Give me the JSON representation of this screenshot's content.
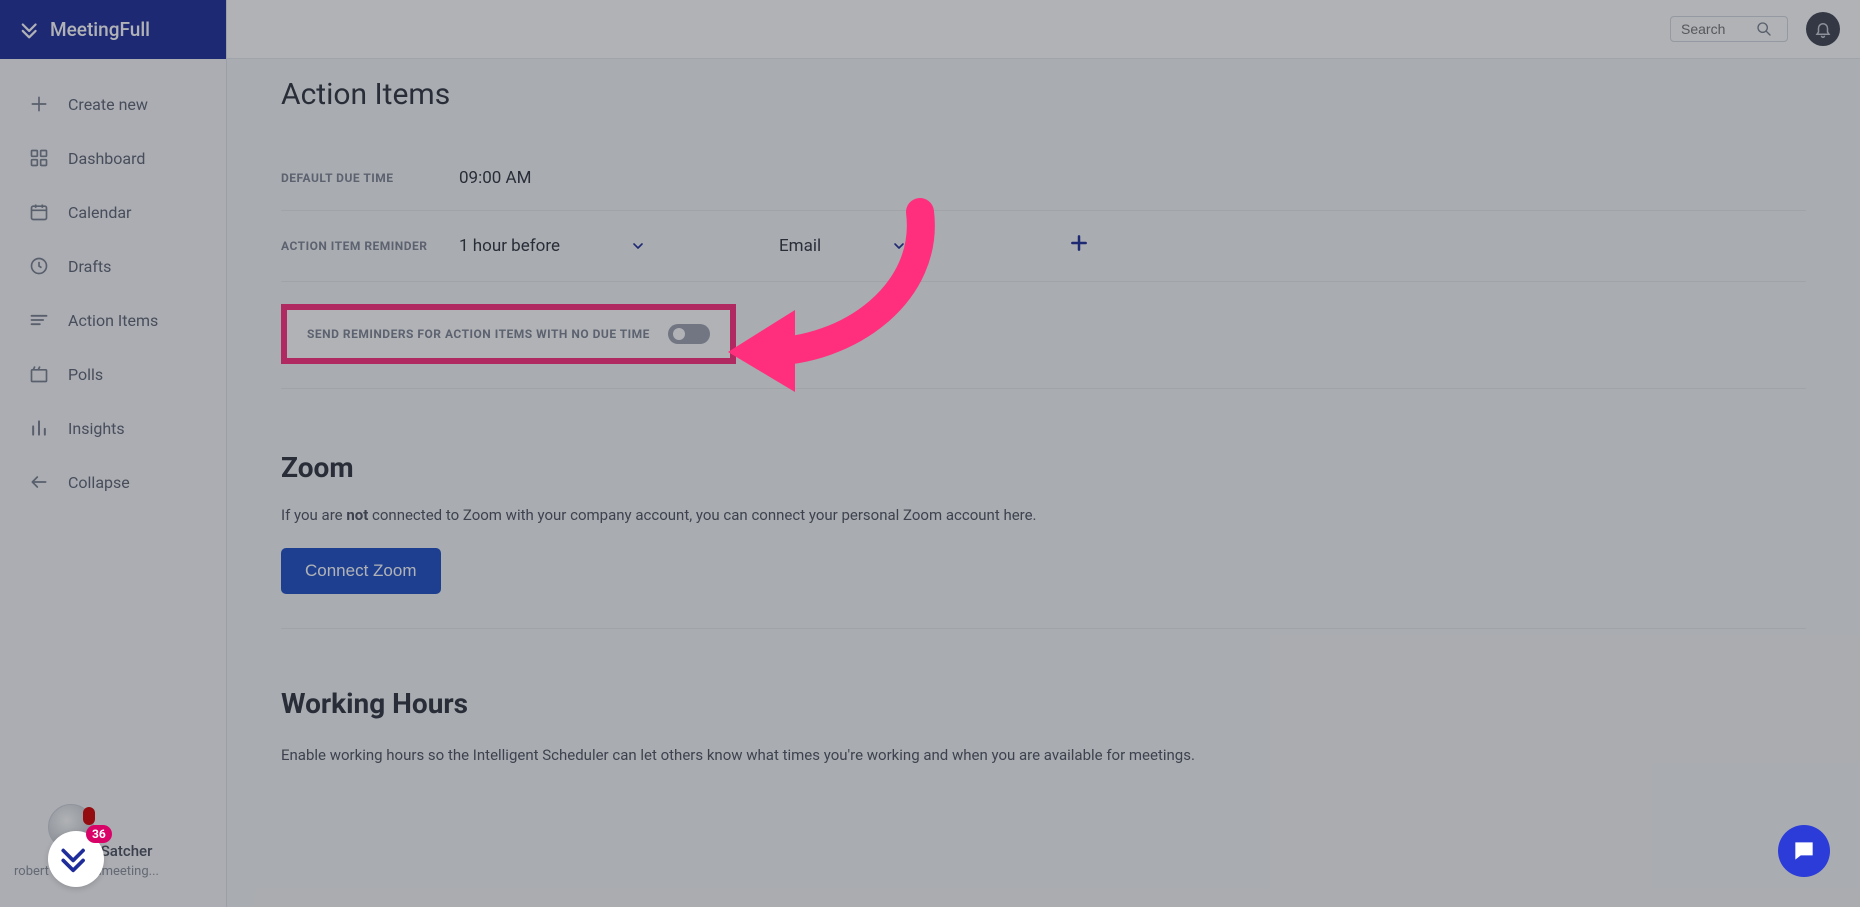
{
  "brand": {
    "name": "MeetingFull"
  },
  "sidebar": {
    "items": [
      {
        "label": "Create new",
        "icon": "plus"
      },
      {
        "label": "Dashboard",
        "icon": "dashboard"
      },
      {
        "label": "Calendar",
        "icon": "calendar"
      },
      {
        "label": "Drafts",
        "icon": "clock"
      },
      {
        "label": "Action Items",
        "icon": "lines"
      },
      {
        "label": "Polls",
        "icon": "polls"
      },
      {
        "label": "Insights",
        "icon": "bars"
      },
      {
        "label": "Collapse",
        "icon": "arrow-left"
      }
    ]
  },
  "user": {
    "name": "t Satcher",
    "email": "robert        r@moonmeeting...",
    "chat_badge": "36"
  },
  "topbar": {
    "search_placeholder": "Search"
  },
  "action_items": {
    "title": "Action Items",
    "default_due_time_label": "DEFAULT DUE TIME",
    "default_due_time_value": "09:00 AM",
    "reminder_label": "ACTION ITEM REMINDER",
    "reminder_time_value": "1 hour before",
    "reminder_channel_value": "Email",
    "no_due_toggle_label": "SEND REMINDERS FOR ACTION ITEMS WITH NO DUE TIME"
  },
  "zoom": {
    "title": "Zoom",
    "desc_prefix": "If you are ",
    "desc_bold": "not",
    "desc_suffix": " connected to Zoom with your company account, you can connect your personal Zoom account here.",
    "connect_label": "Connect Zoom"
  },
  "working_hours": {
    "title": "Working Hours",
    "desc": "Enable working hours so the Intelligent Scheduler can let others know what times you're working and when you are available for meetings."
  },
  "annotation": {
    "arrow_color": "#ff2f7e"
  }
}
